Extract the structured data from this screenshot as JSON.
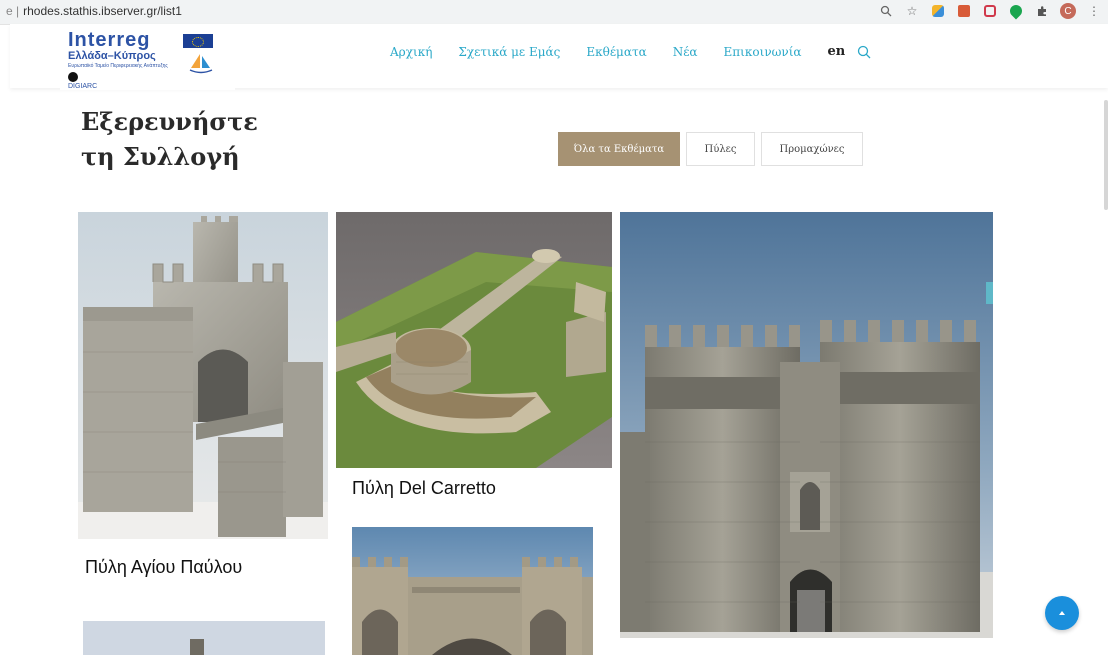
{
  "browser": {
    "url": "rhodes.stathis.ibserver.gr/list1",
    "url_prefix": "e |"
  },
  "logo": {
    "interreg": "Interreg",
    "subtitle": "Ελλάδα–Κύπρος",
    "tagline": "Ευρωπαϊκό Ταμείο Περιφερειακής Ανάπτυξης",
    "digiarc": "DIGIARC"
  },
  "nav": {
    "items": [
      "Αρχική",
      "Σχετικά με Εμάς",
      "Εκθέματα",
      "Νέα",
      "Επικοινωνία"
    ],
    "lang": "en"
  },
  "page": {
    "title_line1": "Εξερευνήστε",
    "title_line2": "τη Συλλογή"
  },
  "filters": [
    "Όλα τα Εκθέματα",
    "Πύλες",
    "Προμαχώνες"
  ],
  "gallery": [
    {
      "caption": "Πύλη Αγίου Παύλου"
    },
    {
      "caption": "Πύλη Del Carretto"
    },
    {
      "caption": ""
    },
    {
      "caption": ""
    },
    {
      "caption": ""
    }
  ],
  "colors": {
    "nav_link": "#2aa8c8",
    "filter_active": "#a69273",
    "scroll_top_button": "#1a8fdc"
  },
  "icons": [
    "search-icon",
    "star-icon",
    "zoom-icon",
    "scroll-top-icon"
  ]
}
